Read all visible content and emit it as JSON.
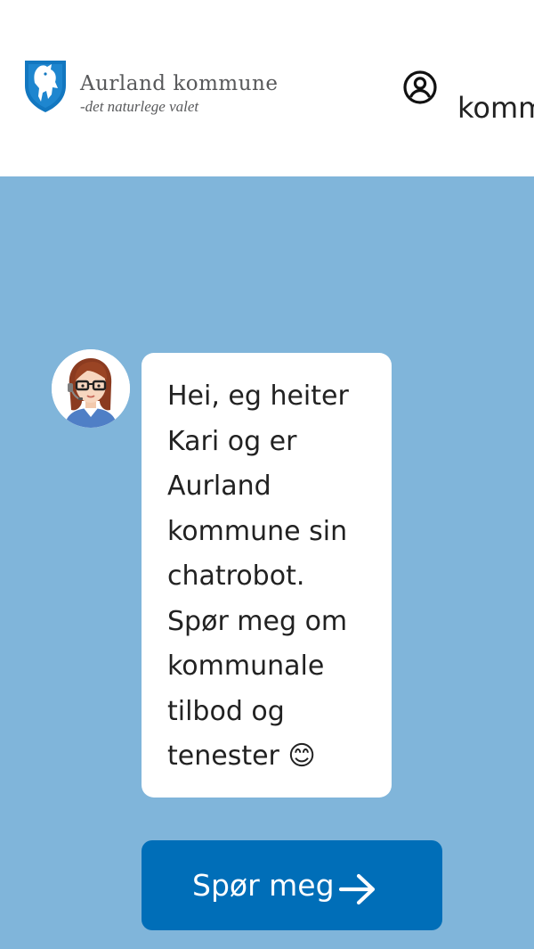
{
  "header": {
    "brand_name": "Aurland kommune",
    "brand_tagline": "-det naturlege valet",
    "logo_icon": "coat-of-arms-goat-icon",
    "login_icon": "user-circle-icon",
    "login_label": "kommune"
  },
  "hero": {
    "background_color": "#80b5da",
    "avatar_icon": "chatbot-avatar-kari",
    "greeting": "Hei, eg heiter Kari og er Aurland kommune sin chatrobot. Spør meg om kommunale tilbod og tenester 😊",
    "ask_button_label": "Spør meg",
    "ask_button_icon": "arrow-right-icon",
    "ask_button_color": "#006eb8"
  }
}
